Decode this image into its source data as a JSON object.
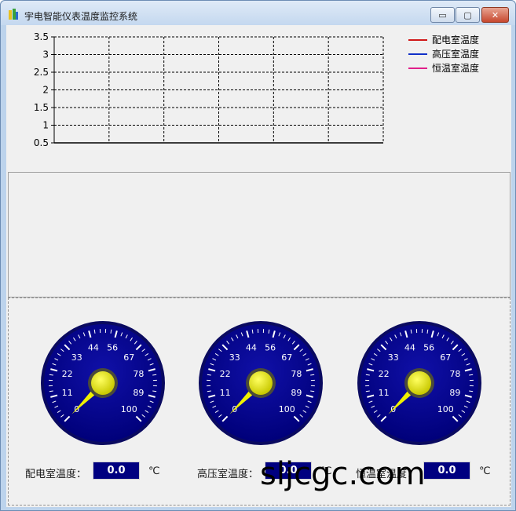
{
  "window": {
    "title": "宇电智能仪表温度监控系统",
    "controls": {
      "minimize": "▭",
      "maximize": "▢",
      "close": "✕"
    }
  },
  "chart_data": {
    "type": "line",
    "title": "",
    "xlabel": "",
    "ylabel": "",
    "ylim": [
      0.5,
      3.5
    ],
    "yticks": [
      "3.5",
      "3",
      "2.5",
      "2",
      "1.5",
      "1",
      "0.5"
    ],
    "grid": true,
    "legend_position": "top-right",
    "series": [
      {
        "name": "配电室温度",
        "color": "#d01818",
        "values": []
      },
      {
        "name": "高压室温度",
        "color": "#1030c8",
        "values": []
      },
      {
        "name": "恒温室温度",
        "color": "#e0208a",
        "values": []
      }
    ]
  },
  "gauges": [
    {
      "label": "配电室温度：",
      "value": "0.0",
      "unit": "℃",
      "reading": 0
    },
    {
      "label": "高压室温度：",
      "value": "0.0",
      "unit": "℃",
      "reading": 0
    },
    {
      "label": "恒温室温度：",
      "value": "0.0",
      "unit": "℃",
      "reading": 0
    }
  ],
  "gauge_scale": [
    "0",
    "11",
    "22",
    "33",
    "44",
    "56",
    "67",
    "78",
    "89",
    "100"
  ],
  "watermark": "sljcgc.com",
  "colors": {
    "gauge_face": "#00007a",
    "needle": "#f0f000",
    "value_bg": "#000080"
  }
}
